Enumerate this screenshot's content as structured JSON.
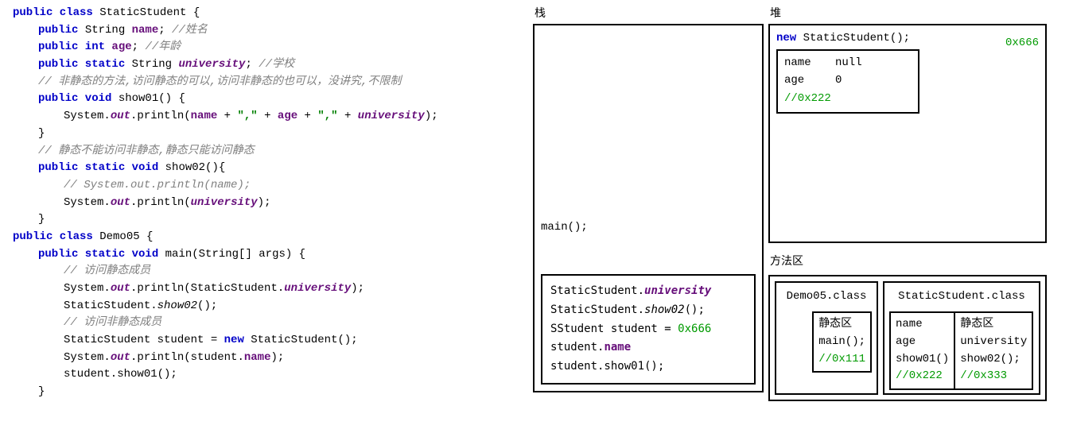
{
  "code": {
    "l1a": "public class ",
    "l1b": "StaticStudent {",
    "l2a": "public ",
    "l2b": "String ",
    "l2c": "name",
    "l2d": "; ",
    "l2e": "//姓名",
    "l3a": "public int ",
    "l3b": "age",
    "l3c": "; ",
    "l3d": "//年龄",
    "l4a": "public static ",
    "l4b": "String ",
    "l4c": "university",
    "l4d": "; ",
    "l4e": "//学校",
    "l5": "// 非静态的方法,访问静态的可以,访问非静态的也可以，没讲究,不限制",
    "l6a": "public void ",
    "l6b": "show01() {",
    "l7a": "System.",
    "l7b": "out",
    "l7c": ".println(",
    "l7d": "name",
    "l7e": " + ",
    "l7f": "\",\"",
    "l7g": " + ",
    "l7h": "age",
    "l7i": " + ",
    "l7j": "\",\"",
    "l7k": " + ",
    "l7l": "university",
    "l7m": ");",
    "l8": "}",
    "l9": "// 静态不能访问非静态,静态只能访问静态",
    "l10a": "public static void ",
    "l10b": "show02(){",
    "l11": "// System.out.println(name);",
    "l12a": "System.",
    "l12b": "out",
    "l12c": ".println(",
    "l12d": "university",
    "l12e": ");",
    "l13": "}",
    "l14a": "public class ",
    "l14b": "Demo05 {",
    "l15a": "public static void ",
    "l15b": "main(String[] args) {",
    "l16": "// 访问静态成员",
    "l17a": "System.",
    "l17b": "out",
    "l17c": ".println(StaticStudent.",
    "l17d": "university",
    "l17e": ");",
    "l18a": "StaticStudent.",
    "l18b": "show02",
    "l18c": "();",
    "l19": "// 访问非静态成员",
    "l20a": "StaticStudent student = ",
    "l20b": "new ",
    "l20c": "StaticStudent();",
    "l21a": "System.",
    "l21b": "out",
    "l21c": ".println(student.",
    "l21d": "name",
    "l21e": ");",
    "l22": "student.show01();",
    "l23": "}"
  },
  "stack": {
    "label": "栈",
    "main": "main();",
    "r1a": "StaticStudent.",
    "r1b": "university",
    "r2a": "StaticStudent.",
    "r2b": "show02",
    "r2c": "();",
    "r3a": "SStudent student = ",
    "r3b": "0x666",
    "r4a": "student.",
    "r4b": "name",
    "r5": "student.show01();"
  },
  "heap": {
    "label": "堆",
    "new_kw": "new ",
    "new_rest": "StaticStudent();",
    "addr": "0x666",
    "row1a": "name",
    "row1b": "null",
    "row2a": "age",
    "row2b": "0",
    "row3": "//0x222"
  },
  "method": {
    "label": "方法区",
    "demo_title": "Demo05.class",
    "demo_static": "静态区",
    "demo_main": "main();",
    "demo_addr": "//0x111",
    "ss_title": "StaticStudent.class",
    "ss_name": "name",
    "ss_age": "age",
    "ss_show01": "show01()",
    "ss_addr1": "//0x222",
    "ss_static": "静态区",
    "ss_univ": "university",
    "ss_show02": "show02();",
    "ss_addr2": "//0x333"
  }
}
